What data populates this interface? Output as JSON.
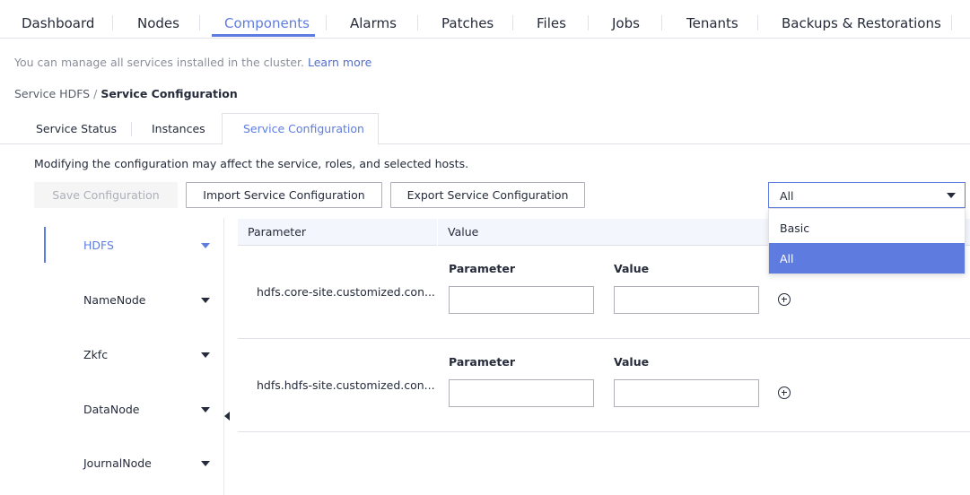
{
  "nav": {
    "tabs": [
      "Dashboard",
      "Nodes",
      "Components",
      "Alarms",
      "Patches",
      "Files",
      "Jobs",
      "Tenants",
      "Backups & Restorations"
    ],
    "active": "Components"
  },
  "intro": {
    "text": "You can manage all services installed in the cluster.",
    "link": "Learn more"
  },
  "breadcrumb": {
    "parent": "Service HDFS",
    "separator": "/",
    "current": "Service Configuration"
  },
  "subtabs": [
    "Service Status",
    "Instances",
    "Service Configuration"
  ],
  "warning": "Modifying the configuration may affect the service, roles, and selected hosts.",
  "toolbar": {
    "save_label": "Save Configuration",
    "import_label": "Import Service Configuration",
    "export_label": "Export Service Configuration"
  },
  "filter": {
    "value": "All",
    "options": [
      "Basic",
      "All"
    ],
    "selected": "All"
  },
  "sidebar": {
    "items": [
      "HDFS",
      "NameNode",
      "Zkfc",
      "DataNode",
      "JournalNode"
    ],
    "active": "HDFS"
  },
  "table": {
    "headers": [
      "Parameter",
      "Value"
    ],
    "sub_headers": [
      "Parameter",
      "Value"
    ],
    "rows": [
      {
        "name": "hdfs.core-site.customized.con..."
      },
      {
        "name": "hdfs.hdfs-site.customized.con..."
      }
    ]
  },
  "colors": {
    "accent": "#5e7ce0",
    "text": "#252b3a",
    "muted": "#8a8e99",
    "border": "#dfe1e6"
  }
}
